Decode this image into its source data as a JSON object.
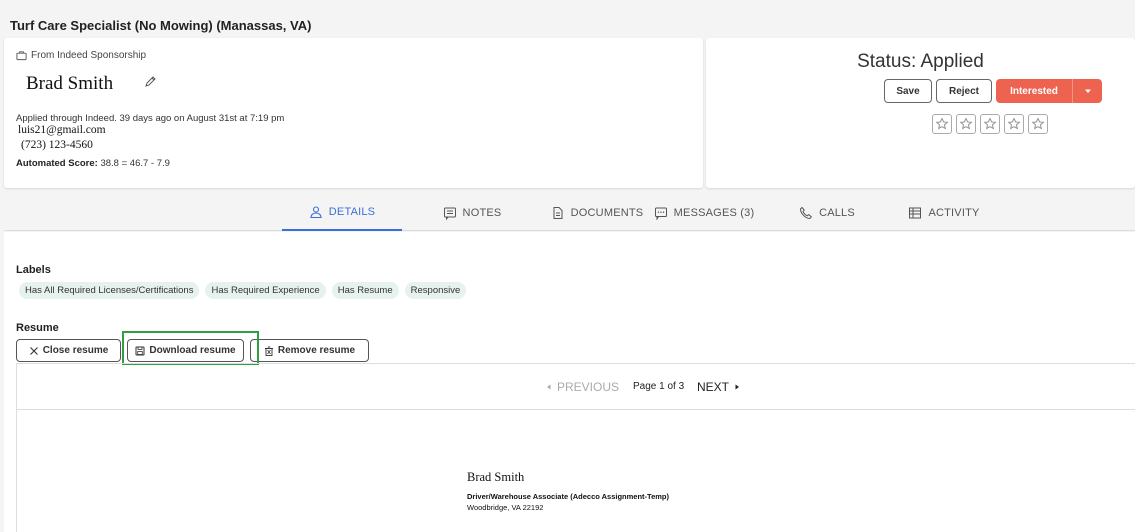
{
  "job_title": "Turf Care Specialist (No Mowing) (Manassas, VA)",
  "candidate": {
    "source": "From Indeed Sponsorship",
    "name": "Brad Smith",
    "applied": "Applied through Indeed. 39 days ago on August 31st at 7:19 pm",
    "email": "luis21@gmail.com",
    "phone": "(723) 123-4560",
    "score_label": "Automated Score:",
    "score_value": "38.8 = 46.7 - 7.9"
  },
  "status_panel": {
    "status": "Status: Applied",
    "save_label": "Save",
    "reject_label": "Reject",
    "interested_label": "Interested",
    "rating": 0,
    "colors": {
      "accent": "#ee6350"
    }
  },
  "tabs": [
    {
      "label": "DETAILS",
      "icon": "person-icon",
      "active": true
    },
    {
      "label": "NOTES",
      "icon": "notes-icon",
      "active": false
    },
    {
      "label": "DOCUMENTS",
      "icon": "document-icon",
      "active": false
    },
    {
      "label": "MESSAGES (3)",
      "icon": "message-icon",
      "active": false
    },
    {
      "label": "CALLS",
      "icon": "phone-icon",
      "active": false
    },
    {
      "label": "ACTIVITY",
      "icon": "activity-icon",
      "active": false
    }
  ],
  "labels": {
    "heading": "Labels",
    "items": [
      "Has All Required Licenses/Certifications",
      "Has Required Experience",
      "Has Resume",
      "Responsive"
    ]
  },
  "resume": {
    "heading": "Resume",
    "close_label": "Close resume",
    "download_label": "Download resume",
    "remove_label": "Remove resume",
    "prev_label": "PREVIOUS",
    "page_info": "Page 1 of 3",
    "next_label": "NEXT",
    "doc_name": "Brad Smith",
    "doc_role": "Driver/Warehouse Associate (Adecco Assignment-Temp)",
    "doc_location": "Woodbridge, VA 22192"
  }
}
